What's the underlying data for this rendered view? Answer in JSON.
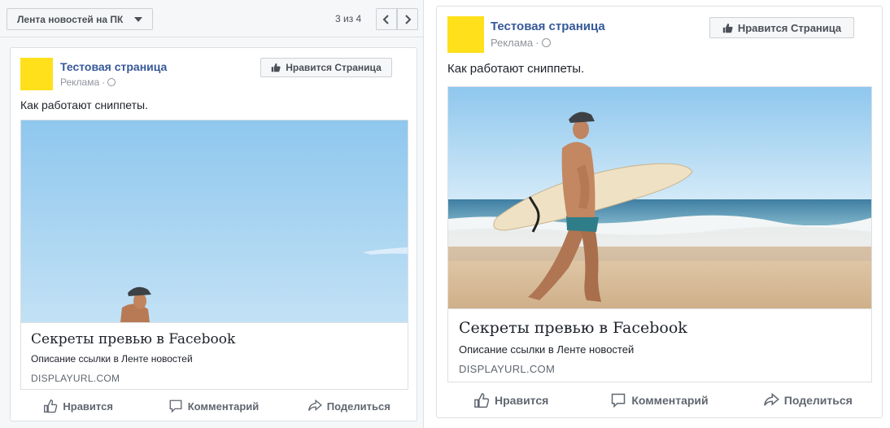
{
  "toolbar": {
    "placement_label": "Лента новостей на ПК",
    "pager_text": "3 из 4"
  },
  "post": {
    "page_name": "Тестовая страница",
    "sponsored": "Реклама",
    "dot": "·",
    "like_page_label": "Нравится Страница",
    "text": "Как работают сниппеты.",
    "link_title": "Секреты превью в Facebook",
    "link_description": "Описание ссылки в Ленте новостей",
    "display_url": "DISPLAYURL.COM",
    "actions": {
      "like": "Нравится",
      "comment": "Комментарий",
      "share": "Поделиться"
    }
  },
  "colors": {
    "avatar": "#ffe01b",
    "page_name": "#365899",
    "sky_top": "#8fc7ee",
    "sea": "#4d8aa9",
    "sand": "#d9c1a0"
  },
  "icons": [
    "caret-down-icon",
    "chevron-left-icon",
    "chevron-right-icon",
    "globe-icon",
    "thumbs-up-icon",
    "comment-icon",
    "share-icon"
  ]
}
